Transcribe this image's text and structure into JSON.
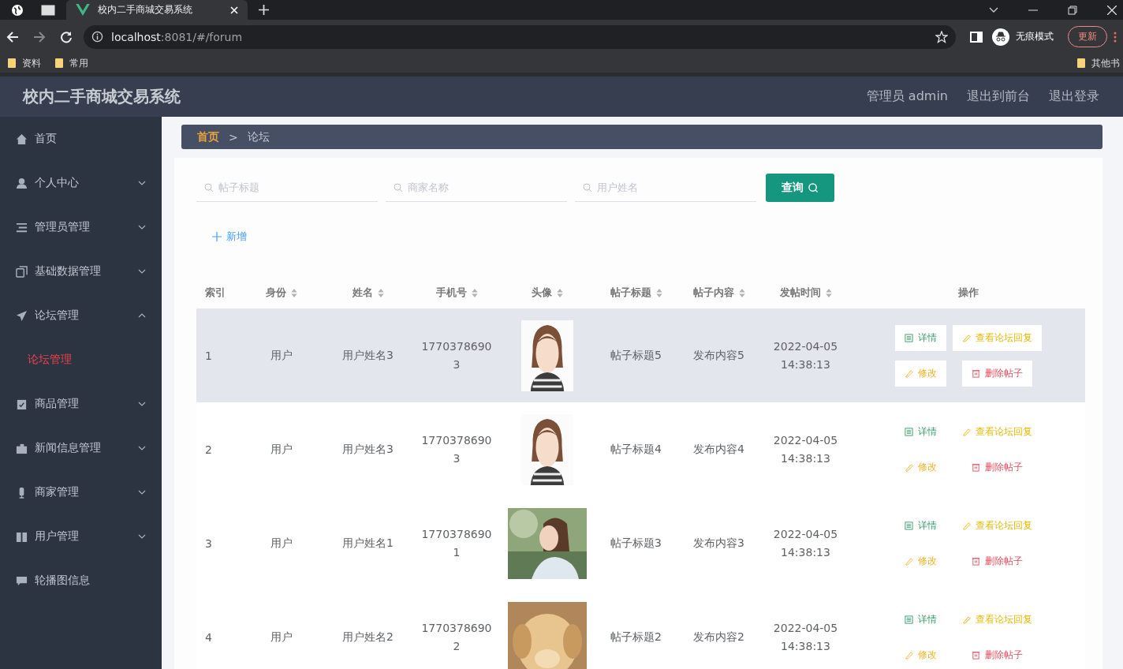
{
  "browser": {
    "tab_title": "校内二手商城交易系统",
    "url_host": "localhost",
    "url_path": ":8081/#/forum",
    "incognito_label": "无痕模式",
    "update_button": "更新",
    "bookmarks": [
      "资料",
      "常用"
    ],
    "other_bookmarks": "其他书"
  },
  "header": {
    "title": "校内二手商城交易系统",
    "links": [
      "管理员 admin",
      "退出到前台",
      "退出登录"
    ]
  },
  "sidebar": {
    "items": [
      {
        "label": "首页"
      },
      {
        "label": "个人中心",
        "expanded": false
      },
      {
        "label": "管理员管理",
        "expanded": false
      },
      {
        "label": "基础数据管理",
        "expanded": false
      },
      {
        "label": "论坛管理",
        "expanded": true,
        "children": [
          {
            "label": "论坛管理",
            "selected": true
          }
        ]
      },
      {
        "label": "商品管理",
        "expanded": false
      },
      {
        "label": "新闻信息管理",
        "expanded": false
      },
      {
        "label": "商家管理",
        "expanded": false
      },
      {
        "label": "用户管理",
        "expanded": false
      },
      {
        "label": "轮播图信息"
      }
    ]
  },
  "breadcrumb": {
    "items": [
      "首页",
      "论坛"
    ],
    "separator": ">"
  },
  "search": {
    "fields": [
      {
        "placeholder": "帖子标题"
      },
      {
        "placeholder": "商家名称"
      },
      {
        "placeholder": "用户姓名"
      }
    ],
    "button": "查询"
  },
  "add_button": "新增",
  "table": {
    "columns": [
      {
        "label": "索引",
        "sortable": false
      },
      {
        "label": "身份",
        "sortable": true
      },
      {
        "label": "姓名",
        "sortable": true
      },
      {
        "label": "手机号",
        "sortable": true
      },
      {
        "label": "头像",
        "sortable": true
      },
      {
        "label": "帖子标题",
        "sortable": true
      },
      {
        "label": "帖子内容",
        "sortable": true
      },
      {
        "label": "发帖时间",
        "sortable": true
      },
      {
        "label": "操作",
        "sortable": false
      }
    ],
    "rows": [
      {
        "index": "1",
        "role": "用户",
        "name": "用户姓名3",
        "phone": [
          "1770378690",
          "3"
        ],
        "avatar": {
          "kind": "picture"
        },
        "title": "帖子标题5",
        "content": "发布内容5",
        "time": [
          "2022-04-05",
          "14:38:13"
        ],
        "highlighted": true,
        "actions": [
          {
            "kind": "detail",
            "label": "详情"
          },
          {
            "kind": "reply",
            "label": "查看论坛回复"
          },
          {
            "kind": "edit",
            "label": "修改"
          },
          {
            "kind": "delete",
            "label": "删除帖子"
          }
        ]
      },
      {
        "index": "2",
        "role": "用户",
        "name": "用户姓名3",
        "phone": [
          "1770378690",
          "3"
        ],
        "avatar": {
          "kind": "picture"
        },
        "title": "帖子标题4",
        "content": "发布内容4",
        "time": [
          "2022-04-05",
          "14:38:13"
        ],
        "highlighted": false,
        "actions": [
          {
            "kind": "detail",
            "label": "详情"
          },
          {
            "kind": "reply",
            "label": "查看论坛回复"
          },
          {
            "kind": "edit",
            "label": "修改"
          },
          {
            "kind": "delete",
            "label": "删除帖子"
          }
        ]
      },
      {
        "index": "3",
        "role": "用户",
        "name": "用户姓名1",
        "phone": [
          "1770378690",
          "1"
        ],
        "avatar": {
          "kind": "picture"
        },
        "title": "帖子标题3",
        "content": "发布内容3",
        "time": [
          "2022-04-05",
          "14:38:13"
        ],
        "highlighted": false,
        "actions": [
          {
            "kind": "detail",
            "label": "详情"
          },
          {
            "kind": "reply",
            "label": "查看论坛回复"
          },
          {
            "kind": "edit",
            "label": "修改"
          },
          {
            "kind": "delete",
            "label": "删除帖子"
          }
        ]
      },
      {
        "index": "4",
        "role": "用户",
        "name": "用户姓名2",
        "phone": [
          "1770378690",
          "2"
        ],
        "avatar": {
          "kind": "picture"
        },
        "title": "帖子标题2",
        "content": "发布内容2",
        "time": [
          "2022-04-05",
          "14:38:13"
        ],
        "highlighted": false,
        "actions": [
          {
            "kind": "detail",
            "label": "详情"
          },
          {
            "kind": "reply",
            "label": "查看论坛回复"
          },
          {
            "kind": "edit",
            "label": "修改"
          },
          {
            "kind": "delete",
            "label": "删除帖子"
          }
        ]
      }
    ]
  }
}
